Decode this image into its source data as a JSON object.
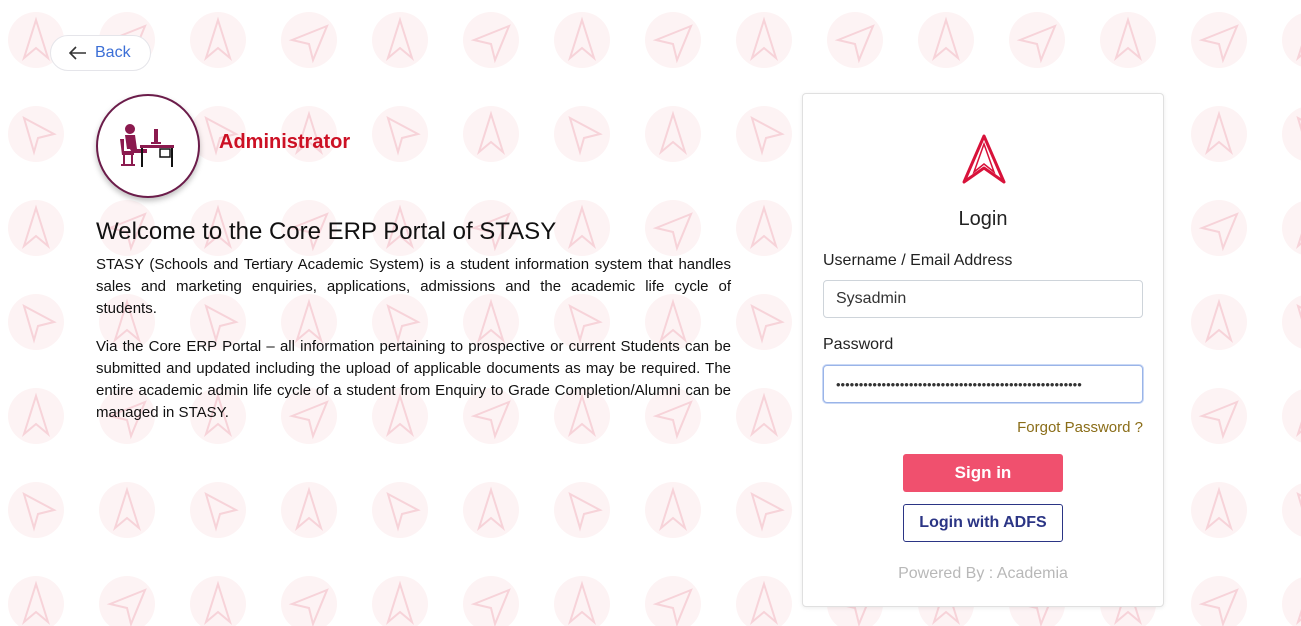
{
  "back": {
    "label": "Back"
  },
  "role": {
    "title": "Administrator",
    "icon": "admin-desk-icon"
  },
  "welcome": {
    "heading": "Welcome to the Core ERP Portal of STASY",
    "paragraph1": "STASY (Schools and Tertiary Academic System) is a student information system that handles sales and marketing enquiries, applications, admissions and the academic life cycle of students.",
    "paragraph2": "Via the Core ERP Portal – all information pertaining to prospective or current Students can be submitted and updated including the upload of applicable documents as may be required. The entire academic admin life cycle of a student from Enquiry to Grade Completion/Alumni can be managed in STASY."
  },
  "login": {
    "title": "Login",
    "username_label": "Username / Email Address",
    "username_value": "Sysadmin",
    "password_label": "Password",
    "password_value": "••••••••••••••••••••••••••••••••••••••••••••••••••••••",
    "forgot": "Forgot Password ?",
    "signin": "Sign in",
    "adfs": "Login with ADFS",
    "powered": "Powered By : Academia"
  },
  "colors": {
    "accent": "#cc1024",
    "signin_bg": "#f0506e",
    "adfs_border": "#2b3585",
    "link_blue": "#3c6fd6",
    "forgot": "#8a6d18"
  }
}
